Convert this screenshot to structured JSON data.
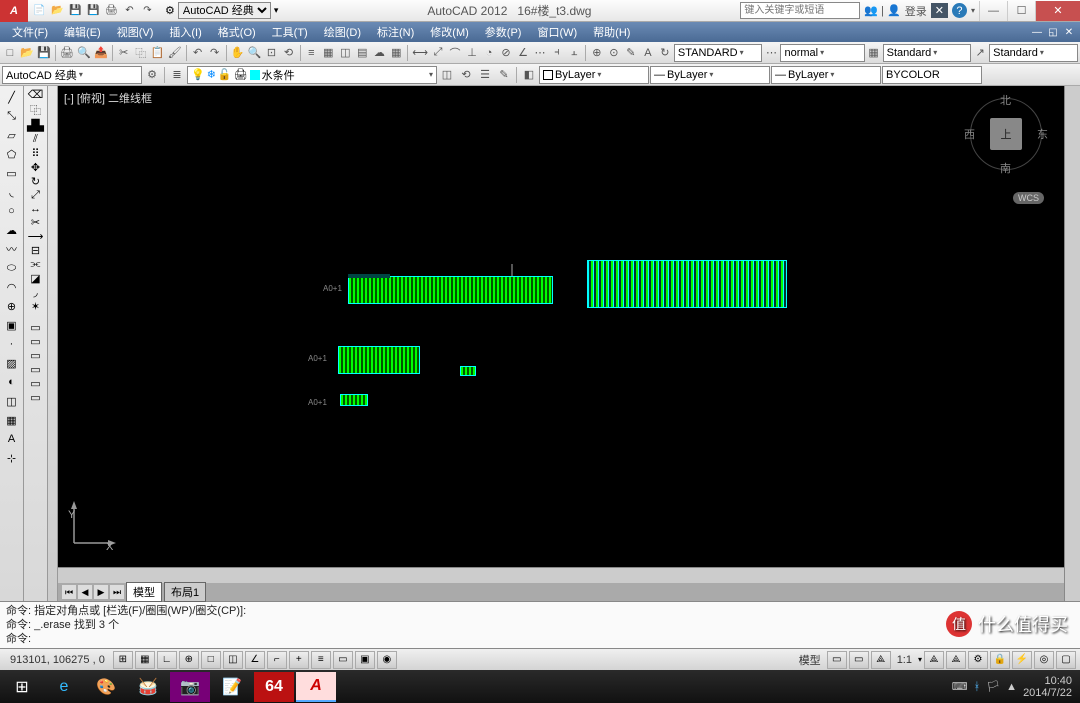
{
  "app": {
    "logo": "A",
    "title_app": "AutoCAD 2012",
    "title_file": "16#楼_t3.dwg",
    "workspace": "AutoCAD 经典",
    "search_placeholder": "键入关键字或短语",
    "login": "登录"
  },
  "menus": [
    "文件(F)",
    "编辑(E)",
    "视图(V)",
    "插入(I)",
    "格式(O)",
    "工具(T)",
    "绘图(D)",
    "标注(N)",
    "修改(M)",
    "参数(P)",
    "窗口(W)",
    "帮助(H)"
  ],
  "props_row": {
    "style1": "STANDARD",
    "style2": "normal",
    "style3": "Standard",
    "style4": "Standard"
  },
  "layer_row": {
    "workspace_sel": "AutoCAD 经典",
    "layer": "水条件",
    "color1": "ByLayer",
    "lw": "ByLayer",
    "plot": "BYCOLOR"
  },
  "viewport": {
    "label": "[-] [俯视] 二维线框",
    "cube_top": "上",
    "north": "北",
    "south": "南",
    "east": "东",
    "west": "西",
    "wcs": "WCS",
    "y": "Y",
    "x": "X"
  },
  "tabs": {
    "model": "模型",
    "layout1": "布局1"
  },
  "cmd": {
    "l1": "命令: 指定对角点或 [栏选(F)/圈围(WP)/圈交(CP)]:",
    "l2": "命令: _.erase 找到 3 个",
    "prompt": "命令:"
  },
  "status": {
    "coords": "913101, 106275 , 0",
    "model": "模型",
    "scale": "1:1"
  },
  "tray": {
    "time": "10:40",
    "date": "2014/7/22"
  },
  "watermark": "什么值得买"
}
